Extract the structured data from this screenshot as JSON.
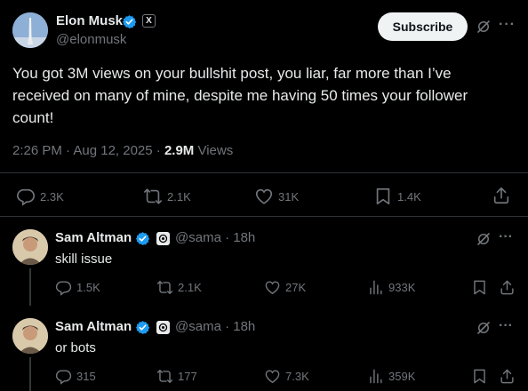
{
  "main_tweet": {
    "author": {
      "name": "Elon Musk",
      "handle": "@elonmusk",
      "badge_letter": "X"
    },
    "subscribe_label": "Subscribe",
    "more_label": "···",
    "text": "You got 3M views on your bullshit post, you liar, far more than I’ve received on many of mine, despite me having 50 times your follower count!",
    "timestamp": "2:26 PM · Aug 12, 2025 · ",
    "views_count": "2.9M",
    "views_label": " Views",
    "stats": {
      "replies": "2.3K",
      "reposts": "2.1K",
      "likes": "31K",
      "bookmarks": "1.4K"
    }
  },
  "replies": [
    {
      "name": "Sam Altman",
      "handle": "@sama · 18h",
      "text": "skill issue",
      "more_label": "···",
      "stats": {
        "replies": "1.5K",
        "reposts": "2.1K",
        "likes": "27K",
        "views": "933K"
      }
    },
    {
      "name": "Sam Altman",
      "handle": "@sama · 18h",
      "text": "or bots",
      "more_label": "···",
      "stats": {
        "replies": "315",
        "reposts": "177",
        "likes": "7.3K",
        "views": "359K"
      }
    }
  ],
  "colors": {
    "background": "#000000",
    "text": "#e7e9ea",
    "muted": "#71767b",
    "verified": "#1d9bf0",
    "divider": "#2f3336"
  },
  "icons": [
    "verified-icon",
    "x-logo-icon",
    "grok-icon",
    "more-icon",
    "reply-icon",
    "repost-icon",
    "like-icon",
    "bookmark-icon",
    "share-icon",
    "views-icon",
    "openai-logo-icon"
  ]
}
